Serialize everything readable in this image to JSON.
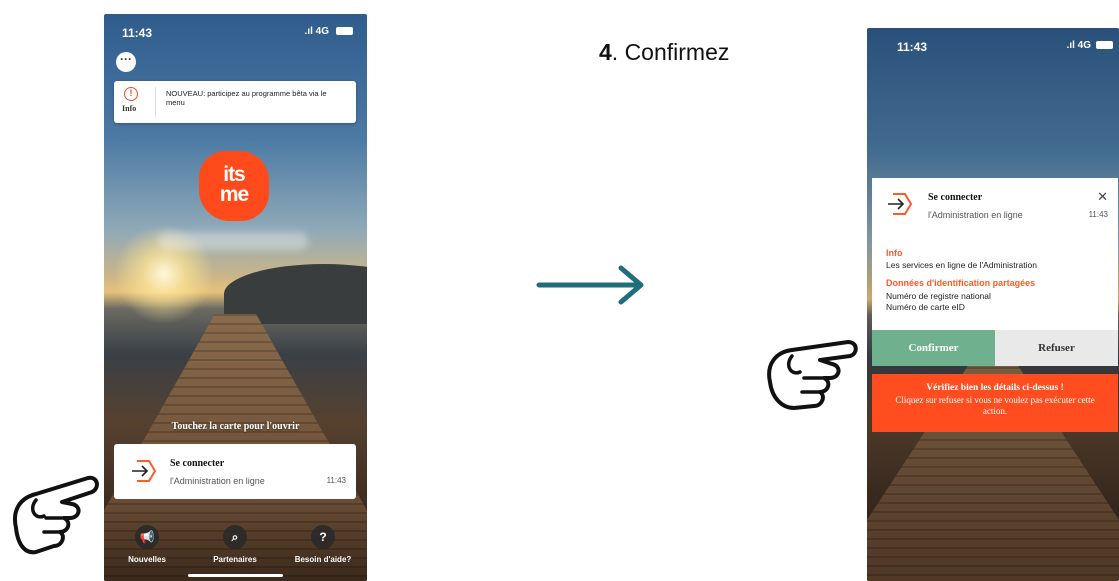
{
  "phone1": {
    "status": {
      "time": "11:43",
      "network": ".ıl 4G"
    },
    "info_banner": {
      "label": "Info",
      "text": "NOUVEAU: participez au programme bêta via le menu"
    },
    "logo": {
      "line1": "its",
      "line2": "me"
    },
    "tap_hint": "Touchez la carte pour l'ouvrir",
    "login_card": {
      "title": "Se connecter",
      "subtitle": "l'Administration en ligne",
      "time": "11:43"
    },
    "nav": [
      {
        "label": "Nouvelles",
        "icon": "megaphone-icon"
      },
      {
        "label": "Partenaires",
        "icon": "search-icon"
      },
      {
        "label": "Besoin d'aide?",
        "icon": "question-icon"
      }
    ]
  },
  "step": {
    "number": "4",
    "text": ". Confirmez"
  },
  "phone2": {
    "status": {
      "time": "11:43",
      "network": ".ıl 4G"
    },
    "card": {
      "title": "Se connecter",
      "subtitle": "l'Administration en ligne",
      "time": "11:43",
      "info_heading": "Info",
      "info_text": "Les services en ligne de l'Administration",
      "data_heading": "Données d'identification partagées",
      "data_items": [
        "Numéro de registre national",
        "Numéro de carte eID"
      ]
    },
    "confirm_label": "Confirmer",
    "refuse_label": "Refuser",
    "warning": {
      "title": "Vérifiez bien les détails ci-dessus !",
      "text": "Cliquez sur refuser si vous ne voulez pas exécuter cette action."
    }
  },
  "colors": {
    "brand": "#ff4a1c",
    "confirm": "#6fb08f",
    "arrow": "#1f6f7a",
    "warning": "#ff4d1f"
  }
}
